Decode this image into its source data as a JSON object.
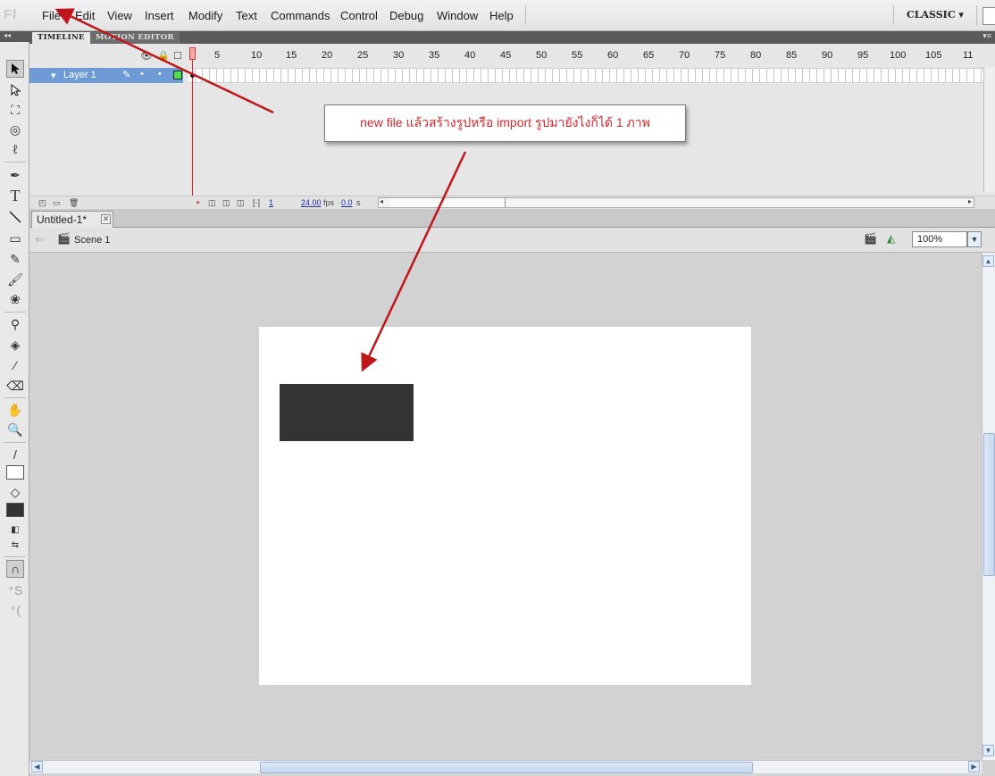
{
  "app": {
    "logo": "Fl",
    "workspace": "CLASSIC ▾"
  },
  "menu": [
    "File",
    "Edit",
    "View",
    "Insert",
    "Modify",
    "Text",
    "Commands",
    "Control",
    "Debug",
    "Window",
    "Help"
  ],
  "tools_header": "◂◂",
  "timeline": {
    "tabs": [
      "TIMELINE",
      "MOTION EDITOR"
    ],
    "ruler": [
      "1",
      "5",
      "10",
      "15",
      "20",
      "25",
      "30",
      "35",
      "40",
      "45",
      "50",
      "55",
      "60",
      "65",
      "70",
      "75",
      "80",
      "85",
      "90",
      "95",
      "100",
      "105",
      "11"
    ],
    "layer_name": "Layer 1",
    "status": {
      "current_frame": "1",
      "fps": "24.00",
      "fps_unit": "fps",
      "time": "0.0",
      "time_unit": "s"
    }
  },
  "document": {
    "tab_title": "Untitled-1*",
    "close_glyph": "✕",
    "scene": "Scene 1",
    "zoom": "100%"
  },
  "annotation": {
    "text": "new file แล้วสร้างรูปหรือ import รูปมายังไงก็ได้ 1 ภาพ"
  },
  "colors": {
    "stage": "#ffffff",
    "shape": "#333333",
    "annotation": "#d4262b",
    "playhead": "#dd2222",
    "layer_selected": "#6e9ad5"
  },
  "icons": [
    "selection-icon",
    "subselection-icon",
    "free-transform-icon",
    "3d-rotation-icon",
    "lasso-icon",
    "pen-icon",
    "text-icon",
    "line-icon",
    "rectangle-icon",
    "pencil-icon",
    "brush-icon",
    "deco-icon",
    "bone-icon",
    "paint-bucket-icon",
    "eyedropper-icon",
    "eraser-icon",
    "hand-icon",
    "zoom-icon",
    "stroke-color-icon",
    "fill-color-icon",
    "swap-colors-icon",
    "snap-to-objects-icon",
    "smooth-icon",
    "straighten-icon"
  ]
}
